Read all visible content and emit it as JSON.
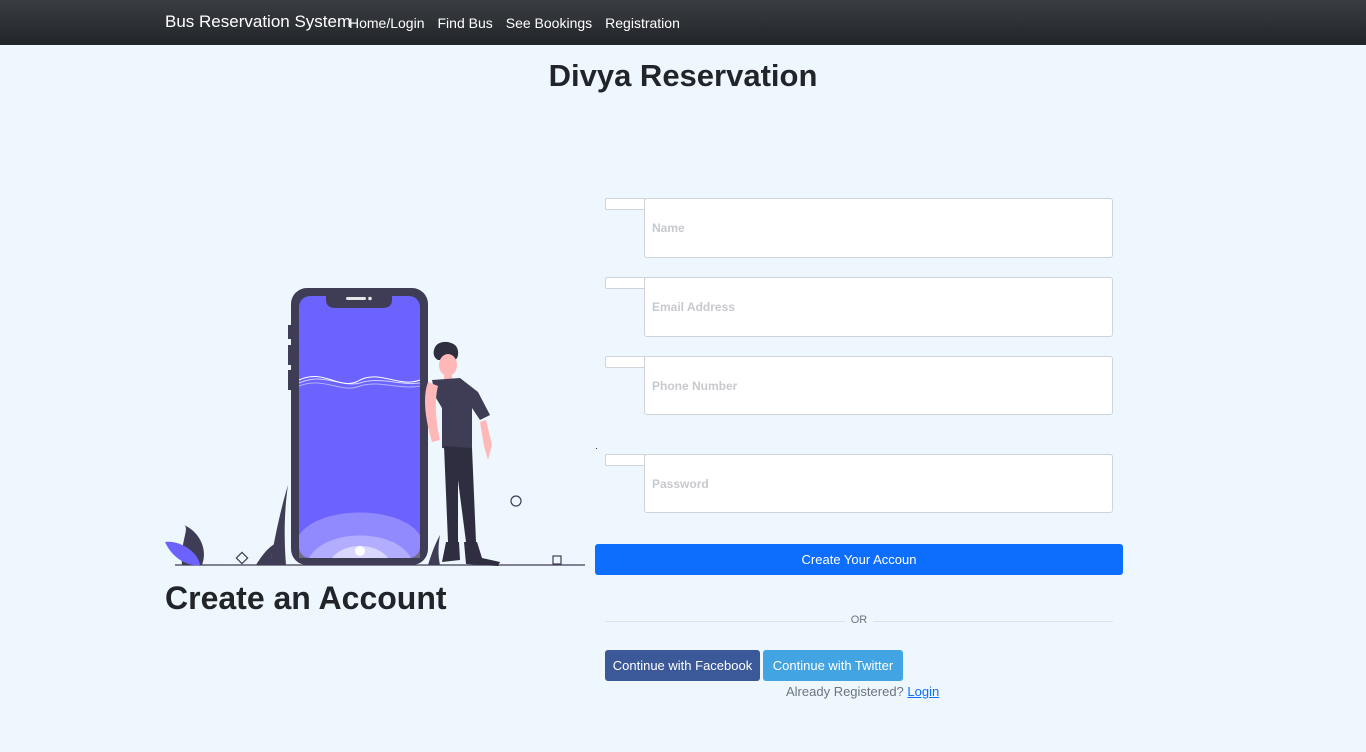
{
  "navbar": {
    "brand": "Bus Reservation System",
    "links": [
      "Home/Login",
      "Find Bus",
      "See Bookings",
      "Registration"
    ]
  },
  "site_title": "Divya Reservation",
  "left": {
    "heading": "Create an Account",
    "illustration_colors": {
      "phone_frame": "#3f3d56",
      "phone_screen": "#6c63ff",
      "accent": "#6c63ff",
      "skin": "#ffb8b8"
    }
  },
  "form": {
    "name_placeholder": "Name",
    "email_placeholder": "Email Address",
    "phone_placeholder": "Phone Number",
    "password_placeholder": "Password",
    "submit_label": "Create Your Accoun",
    "or_label": "OR",
    "facebook_label": "Continue with Facebook",
    "twitter_label": "Continue with Twitter",
    "already_text": "Already Registered?",
    "login_link": "Login"
  },
  "colors": {
    "background": "#eef7fd",
    "primary": "#0d6efd",
    "facebook": "#3b5998",
    "twitter": "#42a4e2",
    "navbar": "#212529"
  }
}
